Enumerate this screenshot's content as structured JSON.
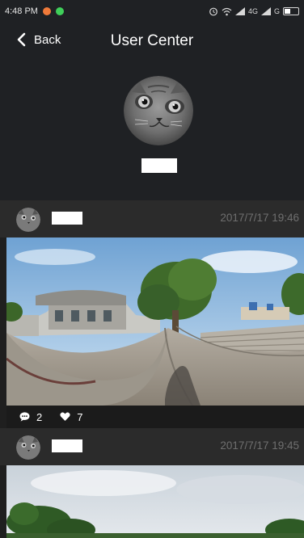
{
  "status_bar": {
    "time": "4:48 PM",
    "network": "4G",
    "icons": [
      "alarm-icon",
      "wifi-icon",
      "signal-icon",
      "signal-icon",
      "battery-icon"
    ],
    "notification_colors": [
      "#f07a3a",
      "#3fcf5a"
    ]
  },
  "header": {
    "back_label": "Back",
    "title": "User Center"
  },
  "posts": [
    {
      "timestamp": "2017/7/17  19:46",
      "comments": "2",
      "likes": "7"
    },
    {
      "timestamp": "2017/7/17  19:45"
    }
  ]
}
